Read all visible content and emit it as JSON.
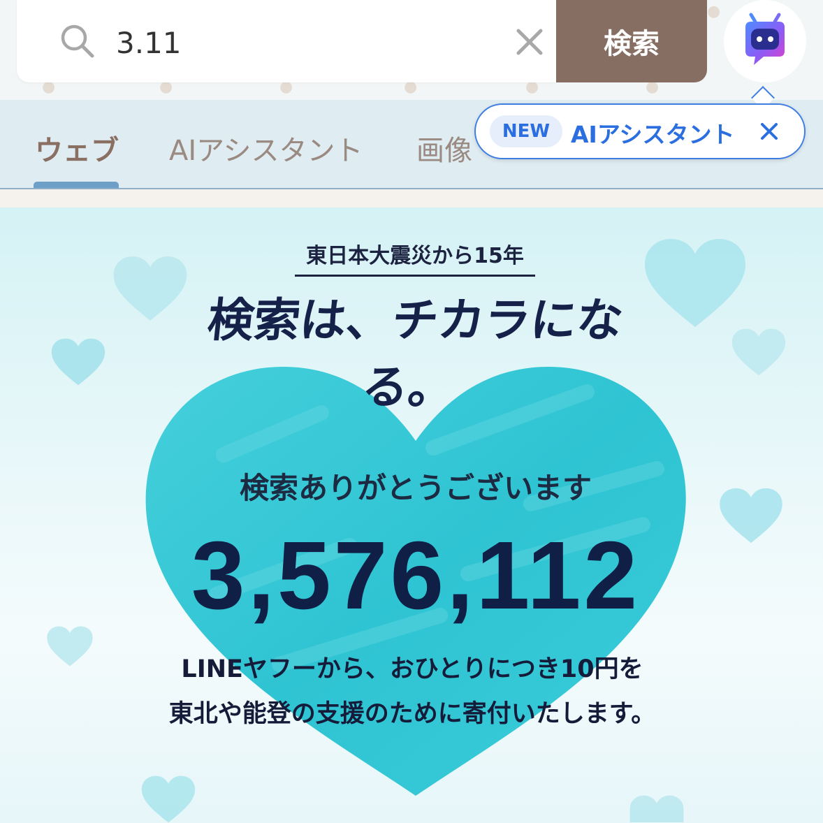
{
  "search": {
    "query": "3.11",
    "submit_label": "検索"
  },
  "tabs": [
    {
      "label": "ウェブ",
      "active": true
    },
    {
      "label": "AIアシスタント",
      "active": false
    },
    {
      "label": "画像",
      "active": false
    }
  ],
  "tooltip": {
    "badge": "NEW",
    "label": "AIアシスタント"
  },
  "banner": {
    "subtitle": "東日本大震災から15年",
    "headline": "検索は、チカラになる。",
    "thanks": "検索ありがとうございます",
    "count": "3,576,112",
    "donation_line1": "LINEヤフーから、おひとりにつき10円を",
    "donation_line2": "東北や能登の支援のために寄付いたします。"
  },
  "colors": {
    "search_button": "#866e63",
    "tab_active": "#8a6f63",
    "tooltip_accent": "#2a6ee0",
    "heart": "#3ecbd8",
    "text_dark": "#0f1f45"
  },
  "icons": [
    "search-icon",
    "clear-icon",
    "assistant-bot-icon",
    "close-icon",
    "heart-icon"
  ]
}
